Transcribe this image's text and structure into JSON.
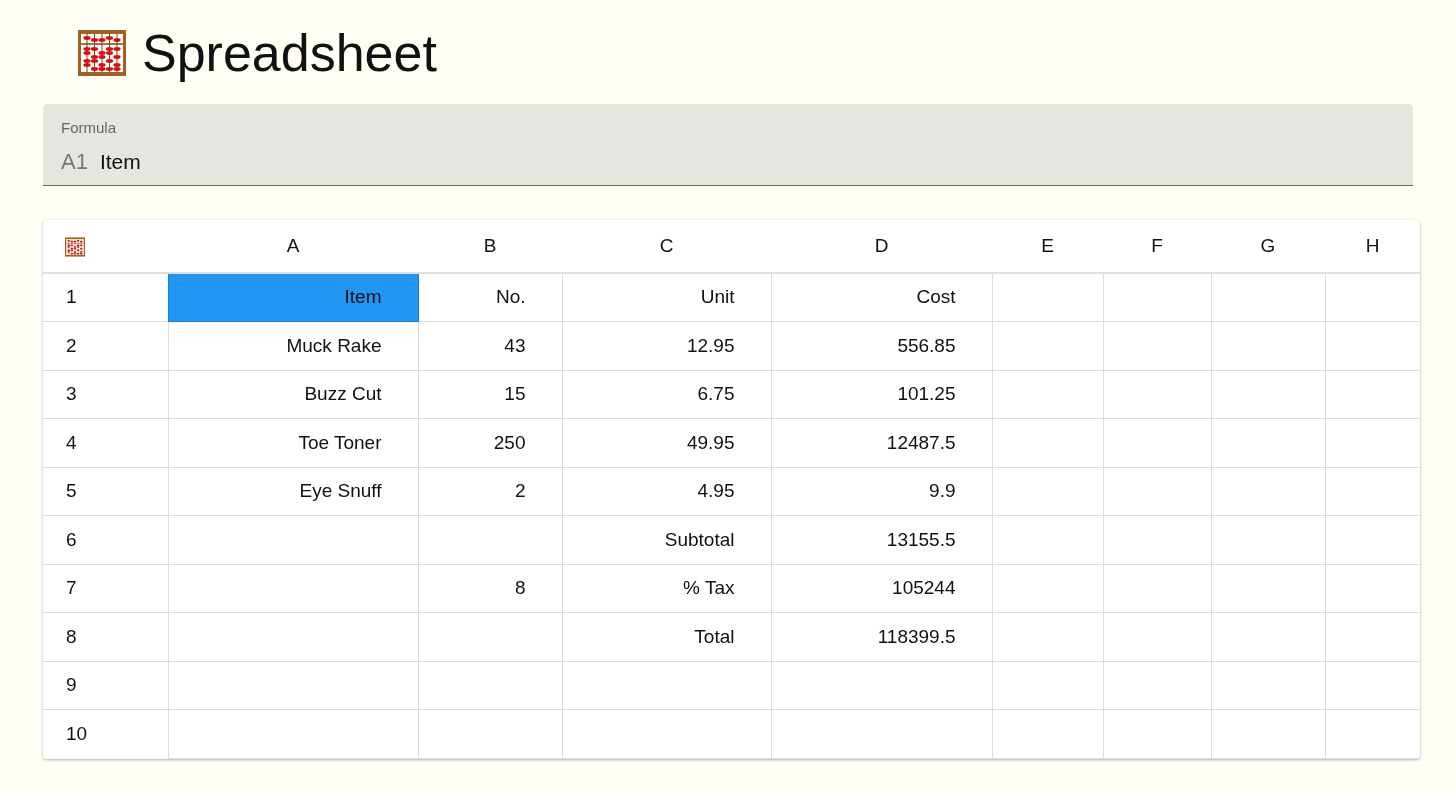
{
  "title": "Spreadsheet",
  "formula": {
    "label": "Formula",
    "cell_ref": "A1",
    "value": "Item"
  },
  "table": {
    "columns": [
      "A",
      "B",
      "C",
      "D",
      "E",
      "F",
      "G",
      "H"
    ],
    "rows": [
      {
        "label": "1",
        "cells": [
          {
            "value": "Item",
            "selected": true
          },
          {
            "value": "No.",
            "selected": false
          },
          {
            "value": "Unit",
            "selected": false
          },
          {
            "value": "Cost",
            "selected": false
          },
          {
            "selected": false
          },
          {
            "selected": false
          },
          {
            "selected": false
          },
          {
            "selected": false
          }
        ]
      },
      {
        "label": "2",
        "cells": [
          {
            "value": "Muck Rake",
            "selected": false
          },
          {
            "value": "43",
            "selected": false
          },
          {
            "value": "12.95",
            "selected": false
          },
          {
            "value": "556.85",
            "selected": false
          },
          {
            "selected": false
          },
          {
            "selected": false
          },
          {
            "selected": false
          },
          {
            "selected": false
          }
        ]
      },
      {
        "label": "3",
        "cells": [
          {
            "value": "Buzz Cut",
            "selected": false
          },
          {
            "value": "15",
            "selected": false
          },
          {
            "value": "6.75",
            "selected": false
          },
          {
            "value": "101.25",
            "selected": false
          },
          {
            "selected": false
          },
          {
            "selected": false
          },
          {
            "selected": false
          },
          {
            "selected": false
          }
        ]
      },
      {
        "label": "4",
        "cells": [
          {
            "value": "Toe Toner",
            "selected": false
          },
          {
            "value": "250",
            "selected": false
          },
          {
            "value": "49.95",
            "selected": false
          },
          {
            "value": "12487.5",
            "selected": false
          },
          {
            "selected": false
          },
          {
            "selected": false
          },
          {
            "selected": false
          },
          {
            "selected": false
          }
        ]
      },
      {
        "label": "5",
        "cells": [
          {
            "value": "Eye Snuff",
            "selected": false
          },
          {
            "value": "2",
            "selected": false
          },
          {
            "value": "4.95",
            "selected": false
          },
          {
            "value": "9.9",
            "selected": false
          },
          {
            "selected": false
          },
          {
            "selected": false
          },
          {
            "selected": false
          },
          {
            "selected": false
          }
        ]
      },
      {
        "label": "6",
        "cells": [
          {
            "selected": false
          },
          {
            "selected": false
          },
          {
            "value": "Subtotal",
            "selected": false
          },
          {
            "value": "13155.5",
            "selected": false
          },
          {
            "selected": false
          },
          {
            "selected": false
          },
          {
            "selected": false
          },
          {
            "selected": false
          }
        ]
      },
      {
        "label": "7",
        "cells": [
          {
            "selected": false
          },
          {
            "value": "8",
            "selected": false
          },
          {
            "value": "% Tax",
            "selected": false
          },
          {
            "value": "105244",
            "selected": false
          },
          {
            "selected": false
          },
          {
            "selected": false
          },
          {
            "selected": false
          },
          {
            "selected": false
          }
        ]
      },
      {
        "label": "8",
        "cells": [
          {
            "selected": false
          },
          {
            "selected": false
          },
          {
            "value": "Total",
            "selected": false
          },
          {
            "value": "118399.5",
            "selected": false
          },
          {
            "selected": false
          },
          {
            "selected": false
          },
          {
            "selected": false
          },
          {
            "selected": false
          }
        ]
      },
      {
        "label": "9",
        "cells": [
          {
            "selected": false
          },
          {
            "selected": false
          },
          {
            "selected": false
          },
          {
            "selected": false
          },
          {
            "selected": false
          },
          {
            "selected": false
          },
          {
            "selected": false
          },
          {
            "selected": false
          }
        ]
      },
      {
        "label": "10",
        "cells": [
          {
            "selected": false
          },
          {
            "selected": false
          },
          {
            "selected": false
          },
          {
            "selected": false
          },
          {
            "selected": false
          },
          {
            "selected": false
          },
          {
            "selected": false
          },
          {
            "selected": false
          }
        ]
      }
    ]
  }
}
